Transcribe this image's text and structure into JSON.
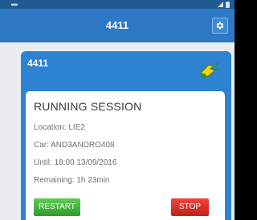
{
  "appbar": {
    "title": "4411",
    "settings_icon": "gear-icon"
  },
  "card": {
    "title": "4411",
    "badge_icon": "car-plug-icon",
    "badge_color": "#ffd400"
  },
  "session": {
    "heading": "RUNNING SESSION",
    "location": "Location: LIE2",
    "car": "Car: AND3ANDRO408",
    "until": "Until: 18:00 13/09/2016",
    "remaining": "Remaining: 1h 23min"
  },
  "actions": {
    "restart_label": "RESTART",
    "stop_label": "STOP"
  },
  "colors": {
    "appbar": "#2d79c6",
    "card": "#2e82d2",
    "restart": "#3fae38",
    "stop": "#e0312a"
  }
}
